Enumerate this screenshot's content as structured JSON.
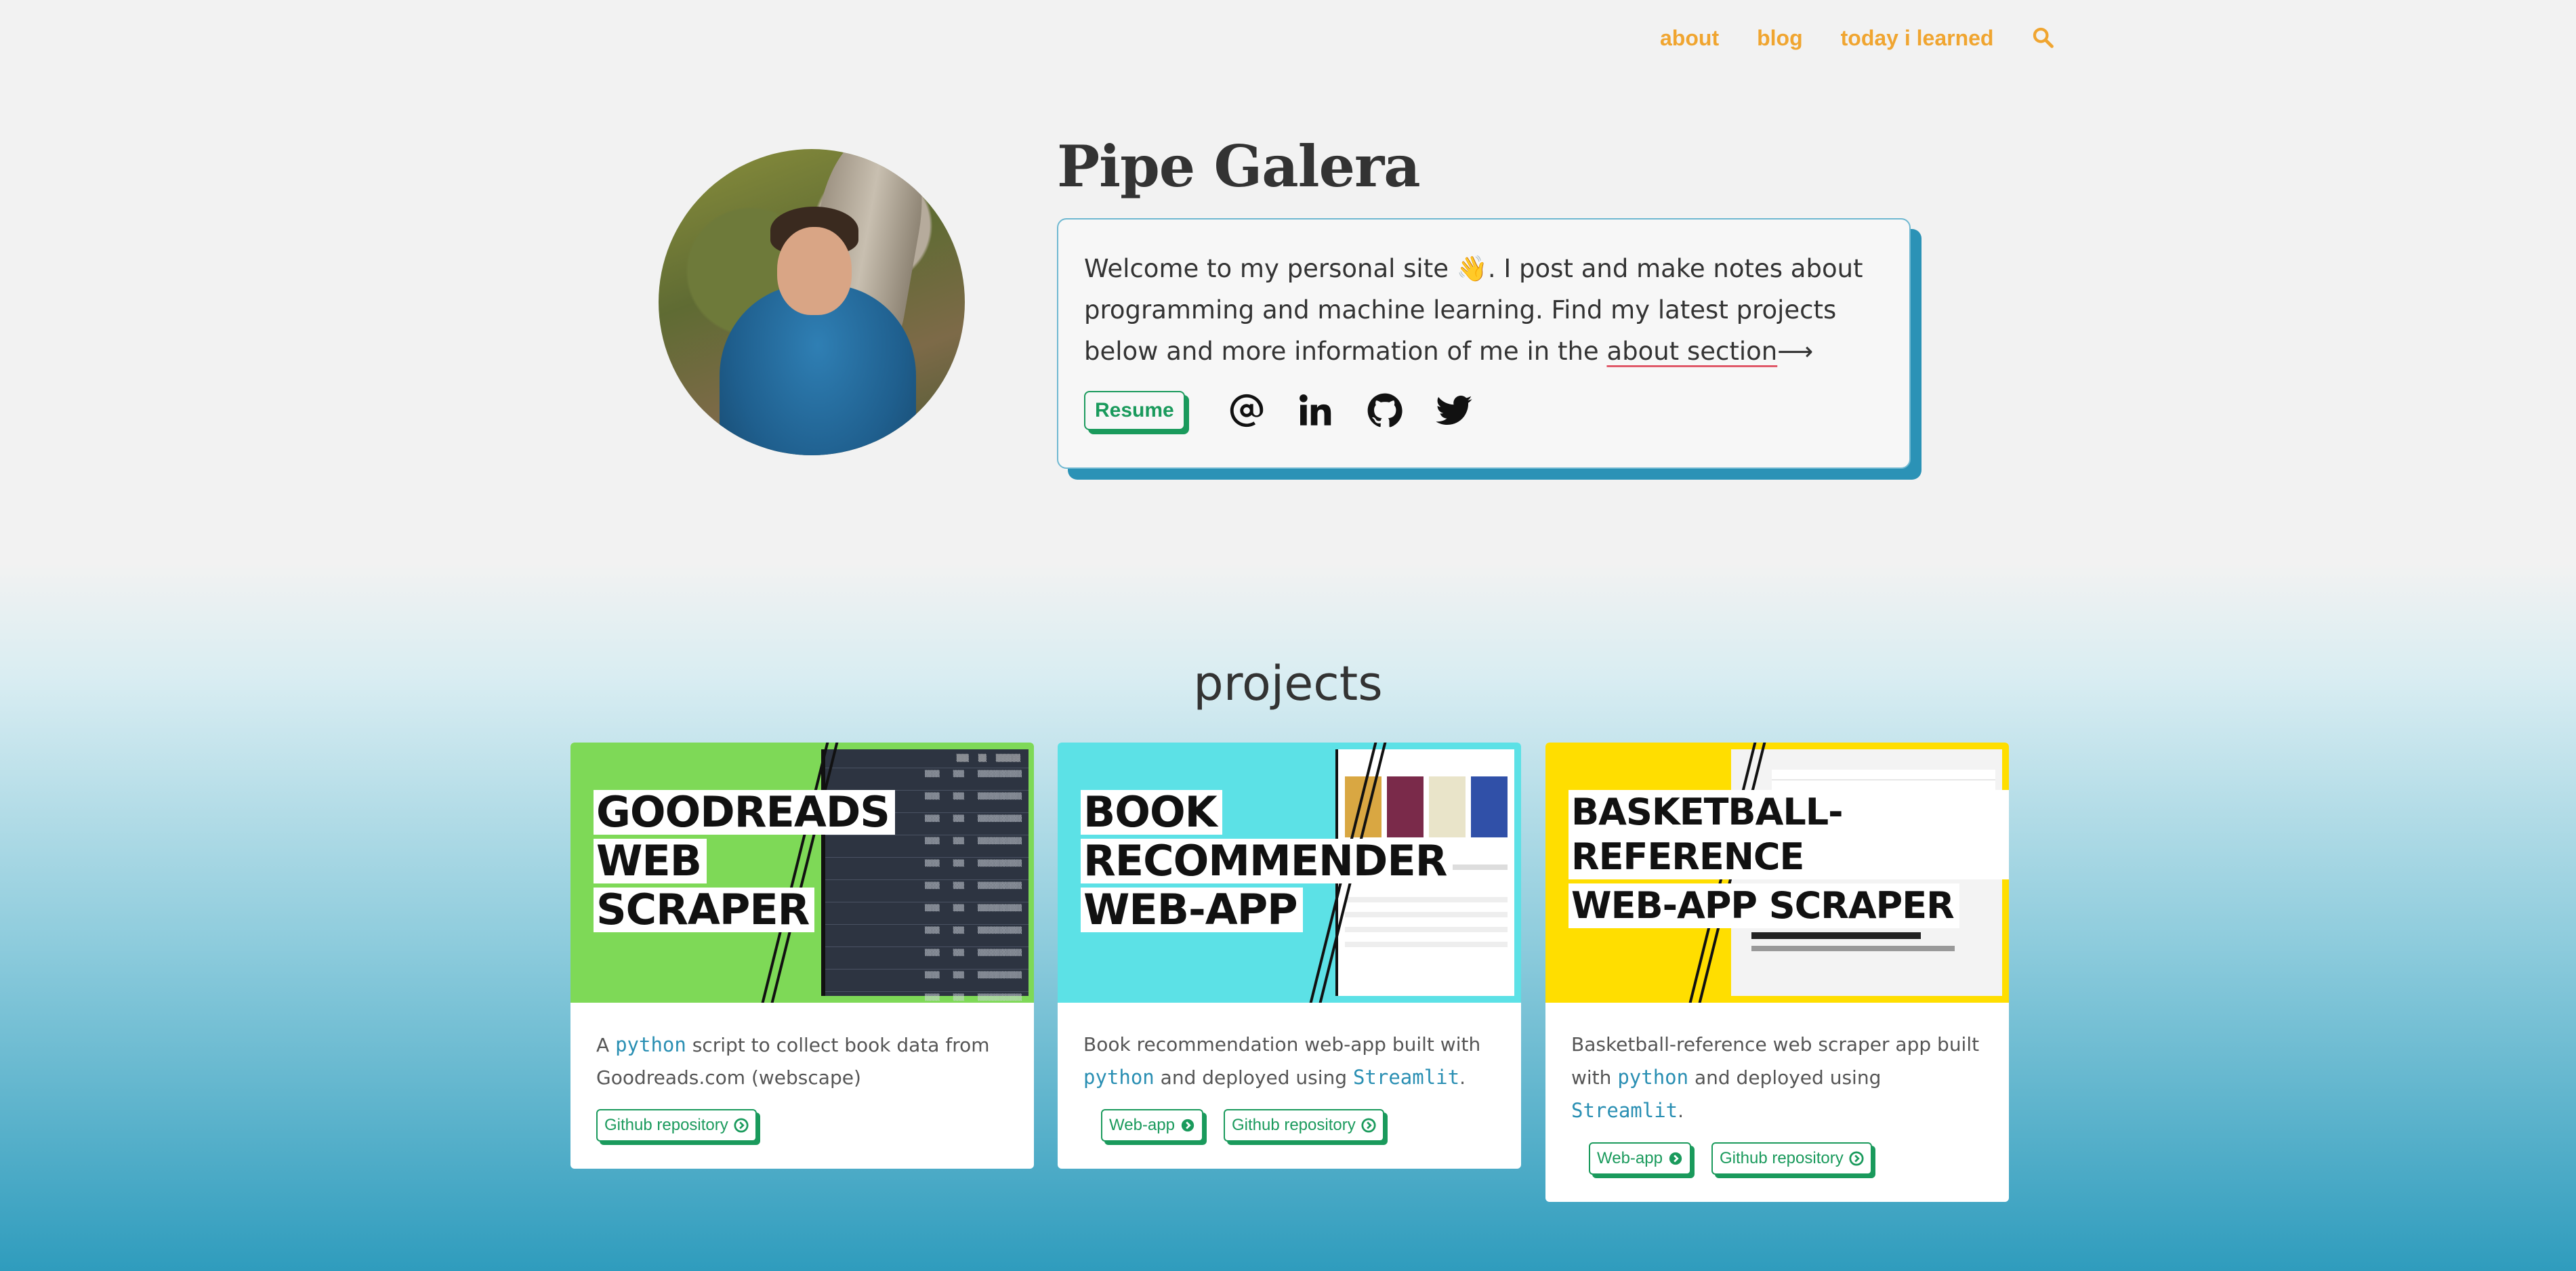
{
  "nav": {
    "links": [
      "about",
      "blog",
      "today i learned"
    ],
    "search_icon": "search-icon"
  },
  "hero": {
    "name": "Pipe Galera",
    "intro_before": "Welcome to my personal site ",
    "intro_emoji": "👋",
    "intro_after": ". I post and make notes about programming and machine learning. Find my latest projects below and more information of me in the ",
    "intro_link": "about section",
    "intro_arrow": "⟶",
    "resume_label": "Resume",
    "social_icons": [
      "email-icon",
      "linkedin-icon",
      "github-icon",
      "twitter-icon"
    ]
  },
  "projects": {
    "title": "projects",
    "items": [
      {
        "banner_lines": [
          "GOODREADS",
          "WEB",
          "SCRAPER"
        ],
        "banner_color": "#7ed957",
        "desc_pre": "A ",
        "desc_code1": "python",
        "desc_mid": " script to collect book data from Goodreads.com (webscape)",
        "buttons": [
          "Github repository"
        ]
      },
      {
        "banner_lines": [
          "BOOK",
          "RECOMMENDER",
          "WEB-APP"
        ],
        "banner_color": "#5ce1e6",
        "desc_pre": "Book recommendation web-app built with ",
        "desc_code1": "python",
        "desc_mid": " and deployed using ",
        "desc_code2": "Streamlit",
        "desc_post": ".",
        "buttons": [
          "Web-app",
          "Github repository"
        ]
      },
      {
        "banner_lines": [
          "BASKETBALL-REFERENCE",
          "WEB-APP SCRAPER"
        ],
        "banner_color": "#ffde00",
        "desc_pre": "Basketball-reference web scraper app built with ",
        "desc_code1": "python",
        "desc_mid": " and deployed using ",
        "desc_code2": "Streamlit",
        "desc_post": ".",
        "buttons": [
          "Web-app",
          "Github repository"
        ]
      }
    ]
  },
  "colors": {
    "nav_link": "#f0a530",
    "accent_green": "#1a9a5c",
    "accent_blue": "#2b92b6",
    "code_blue": "#2a8fb3"
  }
}
